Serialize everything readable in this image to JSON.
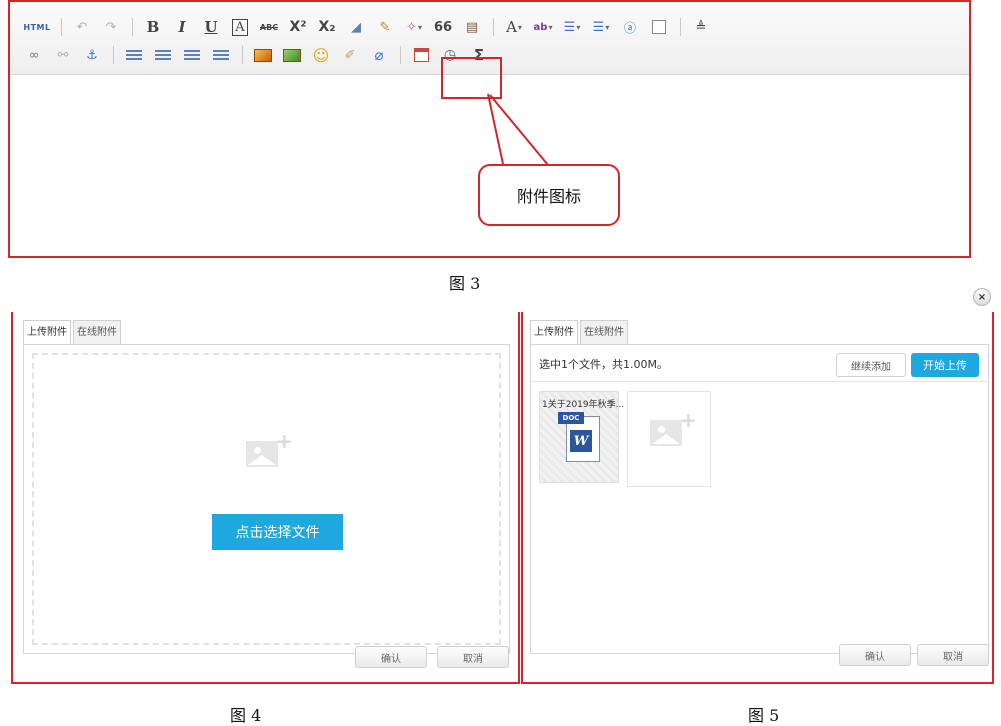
{
  "fig3": {
    "caption": "图 3",
    "toolbar": {
      "html_label": "HTML",
      "row1": [
        "undo-icon",
        "redo-icon",
        "bold-icon",
        "italic-icon",
        "underline-icon",
        "font-border-icon",
        "strikethrough-icon",
        "superscript-icon",
        "subscript-icon",
        "eraser-icon",
        "format-brush-icon",
        "auto-format-icon",
        "blockquote-icon",
        "paste-text-icon",
        "font-color-icon",
        "highlight-icon",
        "ordered-list-icon",
        "unordered-list-icon",
        "insert-code-icon",
        "blank-page-icon",
        "row-spacing-icon"
      ],
      "row2": [
        "link-icon",
        "unlink-icon",
        "anchor-icon",
        "align-left-icon",
        "align-center-icon",
        "align-right-icon",
        "align-justify-icon",
        "image-icon",
        "multi-image-icon",
        "emoticon-icon",
        "scrawl-icon",
        "attachment-icon",
        "date-icon",
        "time-icon",
        "formula-icon"
      ],
      "glyphs": {
        "bold": "B",
        "italic": "I",
        "underline": "U",
        "font_border": "A",
        "strike": "ABC",
        "sup": "X²",
        "sub": "X₂",
        "quote": "66",
        "font_color": "A",
        "highlight": "ab",
        "sigma": "Σ"
      }
    },
    "callout_text": "附件图标"
  },
  "fig4": {
    "caption": "图 4",
    "tabs": [
      "上传附件",
      "在线附件"
    ],
    "choose_button": "点击选择文件",
    "confirm": "确认",
    "cancel": "取消"
  },
  "fig5": {
    "caption": "图 5",
    "tabs": [
      "上传附件",
      "在线附件"
    ],
    "summary": "选中1个文件，共1.00M。",
    "continue_add": "继续添加",
    "start_upload": "开始上传",
    "file": {
      "name": "1关于2019年秋季...",
      "type_tag": "DOC",
      "app_letter": "W"
    },
    "confirm": "确认",
    "cancel": "取消",
    "close_symbol": "×"
  },
  "colors": {
    "annotation_red": "#d2252d",
    "primary_blue": "#1fa8e0",
    "word_blue": "#2b579a"
  }
}
